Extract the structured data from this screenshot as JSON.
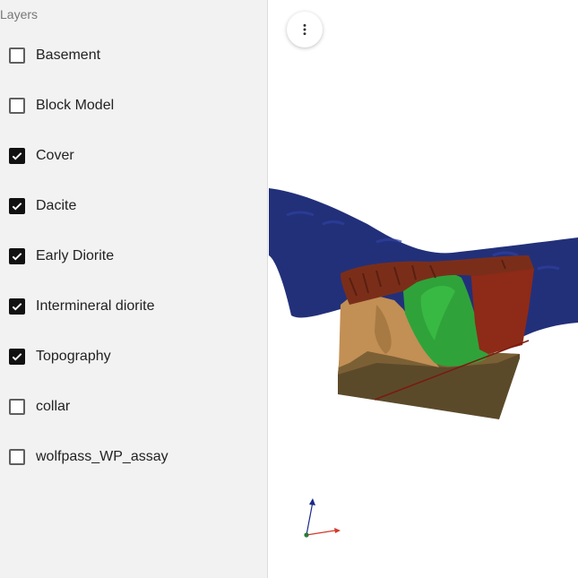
{
  "sidebar": {
    "title": "Layers",
    "layers": [
      {
        "label": "Basement",
        "checked": false
      },
      {
        "label": "Block Model",
        "checked": false
      },
      {
        "label": "Cover",
        "checked": true
      },
      {
        "label": "Dacite",
        "checked": true
      },
      {
        "label": "Early Diorite",
        "checked": true
      },
      {
        "label": "Intermineral diorite",
        "checked": true
      },
      {
        "label": "Topography",
        "checked": true
      },
      {
        "label": "collar",
        "checked": false
      },
      {
        "label": "wolfpass_WP_assay",
        "checked": false
      }
    ]
  },
  "viewport": {
    "menu_icon": "more-vert-icon",
    "colors": {
      "topography": "#22307a",
      "cover": "#7a2e1a",
      "dacite": "#c28f55",
      "early_diorite": "#2fa33a",
      "intermineral_diorite": "#8e2a18",
      "basement_block": "#5b4a2a",
      "axis_x": "#d23a2a",
      "axis_y": "#1a2a8a",
      "axis_z": "#2a7a3a"
    }
  }
}
